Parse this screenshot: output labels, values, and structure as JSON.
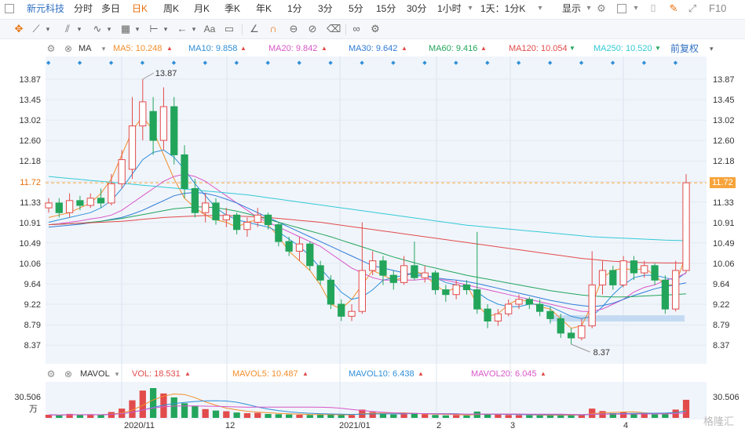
{
  "toolbar": {
    "stock_name": "新元科技",
    "periods": [
      {
        "label": "分时",
        "active": false
      },
      {
        "label": "多日",
        "active": false
      },
      {
        "label": "日K",
        "active": true
      },
      {
        "label": "周K",
        "active": false
      },
      {
        "label": "月K",
        "active": false
      },
      {
        "label": "季K",
        "active": false
      },
      {
        "label": "年K",
        "active": false
      },
      {
        "label": "1分",
        "active": false
      },
      {
        "label": "3分",
        "active": false
      },
      {
        "label": "5分",
        "active": false
      },
      {
        "label": "15分",
        "active": false
      },
      {
        "label": "30分",
        "active": false
      },
      {
        "label": "1小时",
        "active": false
      },
      {
        "label": "1天：1分K",
        "active": false
      }
    ],
    "display_label": "显示",
    "f10_label": "F10"
  },
  "ma_legend": {
    "title": "MA",
    "items": [
      {
        "label": "MA5: 10.248",
        "color": "#f28e2b",
        "trend": "up"
      },
      {
        "label": "MA10: 9.858",
        "color": "#2f8fd8",
        "trend": "up"
      },
      {
        "label": "MA20: 9.842",
        "color": "#d957c8",
        "trend": "up"
      },
      {
        "label": "MA30: 9.642",
        "color": "#2f7bd8",
        "trend": "up"
      },
      {
        "label": "MA60: 9.416",
        "color": "#22a55b",
        "trend": "up"
      },
      {
        "label": "MA120: 10.054",
        "color": "#e24b4b",
        "trend": "down"
      },
      {
        "label": "MA250: 10.520",
        "color": "#33c9d6",
        "trend": "down"
      }
    ],
    "adjust_label": "前复权"
  },
  "price_axis": [
    "13.87",
    "13.45",
    "13.02",
    "12.60",
    "12.18",
    "11.72",
    "11.33",
    "10.91",
    "10.49",
    "10.06",
    "9.64",
    "9.22",
    "8.79",
    "8.37"
  ],
  "current_price": "11.72",
  "high_label": "13.87",
  "low_label": "8.37",
  "vol_legend": {
    "title": "MAVOL",
    "items": [
      {
        "label": "VOL: 18.531",
        "color": "#e24b4b",
        "trend": "up"
      },
      {
        "label": "MAVOL5: 10.487",
        "color": "#f28e2b",
        "trend": "up"
      },
      {
        "label": "MAVOL10: 6.438",
        "color": "#2f8fd8",
        "trend": "up"
      },
      {
        "label": "MAVOL20: 6.045",
        "color": "#d957c8",
        "trend": "up"
      }
    ],
    "axis_max": "30.506",
    "axis_unit": "万"
  },
  "x_axis": [
    "2020/11",
    "12",
    "2021/01",
    "2",
    "3",
    "4"
  ],
  "watermark": "格隆汇",
  "colors": {
    "up": "#e24b4b",
    "down": "#22a55b",
    "accent": "#e8700d",
    "bg": "#f0f5fb"
  },
  "chart_data": {
    "type": "candlestick",
    "ylim": [
      8.37,
      13.87
    ],
    "series": [
      {
        "name": "MA5",
        "values": [
          11.0,
          11.05,
          11.1,
          11.2,
          11.3,
          11.5,
          11.8,
          12.3,
          12.8,
          13.1,
          12.8,
          12.3,
          11.8,
          11.4,
          11.2,
          11.05,
          10.95,
          10.9,
          10.8,
          10.9,
          10.95,
          10.85,
          10.6,
          10.3,
          10.1,
          9.9,
          9.6,
          9.2,
          9.1,
          9.3,
          9.6,
          9.9,
          9.8,
          9.7,
          9.75,
          9.9,
          9.8,
          9.6,
          9.45,
          9.55,
          9.6,
          9.2,
          8.95,
          9.0,
          9.2,
          9.3,
          9.25,
          9.15,
          9.1,
          8.9,
          8.7,
          8.75,
          9.2,
          9.75,
          9.9,
          9.95,
          9.9,
          9.95,
          9.8,
          9.6,
          9.6,
          10.248
        ]
      },
      {
        "name": "MA10",
        "values": [
          10.9,
          10.95,
          11.0,
          11.05,
          11.1,
          11.2,
          11.35,
          11.6,
          11.9,
          12.2,
          12.35,
          12.4,
          12.25,
          12.0,
          11.7,
          11.45,
          11.2,
          11.05,
          10.95,
          10.9,
          10.85,
          10.8,
          10.7,
          10.55,
          10.4,
          10.2,
          9.95,
          9.7,
          9.45,
          9.3,
          9.35,
          9.5,
          9.7,
          9.75,
          9.8,
          9.85,
          9.8,
          9.75,
          9.65,
          9.6,
          9.55,
          9.45,
          9.3,
          9.2,
          9.15,
          9.15,
          9.2,
          9.2,
          9.15,
          9.05,
          8.95,
          8.9,
          8.95,
          9.15,
          9.4,
          9.6,
          9.75,
          9.8,
          9.8,
          9.75,
          9.7,
          9.858
        ]
      },
      {
        "name": "MA20",
        "values": [
          10.85,
          10.87,
          10.9,
          10.93,
          10.97,
          11.0,
          11.05,
          11.15,
          11.3,
          11.45,
          11.6,
          11.75,
          11.85,
          11.9,
          11.85,
          11.75,
          11.6,
          11.45,
          11.3,
          11.15,
          11.0,
          10.9,
          10.8,
          10.7,
          10.6,
          10.5,
          10.4,
          10.25,
          10.1,
          9.95,
          9.85,
          9.75,
          9.7,
          9.7,
          9.7,
          9.7,
          9.72,
          9.72,
          9.7,
          9.65,
          9.6,
          9.55,
          9.5,
          9.45,
          9.4,
          9.35,
          9.3,
          9.25,
          9.2,
          9.15,
          9.1,
          9.05,
          9.05,
          9.1,
          9.2,
          9.3,
          9.45,
          9.55,
          9.6,
          9.7,
          9.75,
          9.842
        ]
      },
      {
        "name": "MA30",
        "values": [
          10.8,
          10.82,
          10.84,
          10.86,
          10.89,
          10.92,
          10.96,
          11.0,
          11.07,
          11.15,
          11.25,
          11.35,
          11.45,
          11.5,
          11.52,
          11.5,
          11.45,
          11.38,
          11.3,
          11.2,
          11.1,
          11.0,
          10.9,
          10.8,
          10.7,
          10.6,
          10.5,
          10.4,
          10.3,
          10.2,
          10.1,
          10.0,
          9.95,
          9.9,
          9.85,
          9.8,
          9.78,
          9.75,
          9.72,
          9.7,
          9.67,
          9.63,
          9.58,
          9.53,
          9.48,
          9.43,
          9.38,
          9.33,
          9.28,
          9.24,
          9.2,
          9.17,
          9.15,
          9.17,
          9.22,
          9.3,
          9.38,
          9.45,
          9.52,
          9.57,
          9.6,
          9.642
        ]
      },
      {
        "name": "MA60",
        "values": [
          10.85,
          10.86,
          10.87,
          10.88,
          10.9,
          10.92,
          10.95,
          10.98,
          11.02,
          11.06,
          11.1,
          11.14,
          11.18,
          11.2,
          11.22,
          11.22,
          11.2,
          11.17,
          11.13,
          11.08,
          11.02,
          10.96,
          10.9,
          10.84,
          10.78,
          10.72,
          10.66,
          10.6,
          10.53,
          10.46,
          10.39,
          10.32,
          10.25,
          10.18,
          10.12,
          10.06,
          10.0,
          9.95,
          9.9,
          9.85,
          9.8,
          9.76,
          9.72,
          9.68,
          9.64,
          9.6,
          9.56,
          9.52,
          9.48,
          9.45,
          9.42,
          9.39,
          9.37,
          9.36,
          9.35,
          9.35,
          9.36,
          9.37,
          9.38,
          9.39,
          9.4,
          9.416
        ]
      },
      {
        "name": "MA120",
        "values": [
          10.85,
          10.86,
          10.87,
          10.88,
          10.89,
          10.9,
          10.91,
          10.92,
          10.94,
          10.96,
          10.98,
          11.0,
          11.01,
          11.02,
          11.03,
          11.04,
          11.04,
          11.04,
          11.03,
          11.02,
          11.01,
          11.0,
          10.98,
          10.96,
          10.94,
          10.92,
          10.9,
          10.87,
          10.84,
          10.81,
          10.78,
          10.75,
          10.72,
          10.69,
          10.66,
          10.63,
          10.6,
          10.57,
          10.54,
          10.51,
          10.48,
          10.45,
          10.42,
          10.39,
          10.36,
          10.33,
          10.3,
          10.27,
          10.24,
          10.21,
          10.18,
          10.15,
          10.13,
          10.11,
          10.09,
          10.08,
          10.07,
          10.06,
          10.06,
          10.055,
          10.055,
          10.054
        ]
      },
      {
        "name": "MA250",
        "values": [
          11.85,
          11.83,
          11.81,
          11.79,
          11.77,
          11.75,
          11.73,
          11.71,
          11.69,
          11.67,
          11.65,
          11.63,
          11.61,
          11.59,
          11.57,
          11.55,
          11.53,
          11.51,
          11.49,
          11.47,
          11.44,
          11.41,
          11.38,
          11.35,
          11.32,
          11.29,
          11.26,
          11.23,
          11.2,
          11.17,
          11.14,
          11.11,
          11.08,
          11.05,
          11.02,
          10.99,
          10.96,
          10.93,
          10.9,
          10.87,
          10.84,
          10.82,
          10.8,
          10.78,
          10.76,
          10.74,
          10.72,
          10.7,
          10.68,
          10.66,
          10.64,
          10.62,
          10.6,
          10.59,
          10.58,
          10.57,
          10.56,
          10.55,
          10.54,
          10.53,
          10.525,
          10.52
        ]
      }
    ],
    "candles": [
      {
        "o": 11.2,
        "c": 11.3,
        "h": 11.4,
        "l": 11.1
      },
      {
        "o": 11.3,
        "c": 11.1,
        "h": 11.4,
        "l": 11.0
      },
      {
        "o": 11.1,
        "c": 11.35,
        "h": 11.5,
        "l": 11.0
      },
      {
        "o": 11.35,
        "c": 11.25,
        "h": 11.45,
        "l": 11.15
      },
      {
        "o": 11.25,
        "c": 11.4,
        "h": 11.5,
        "l": 11.2
      },
      {
        "o": 11.4,
        "c": 11.3,
        "h": 11.6,
        "l": 11.2
      },
      {
        "o": 11.3,
        "c": 11.7,
        "h": 11.9,
        "l": 11.25
      },
      {
        "o": 11.7,
        "c": 12.2,
        "h": 12.4,
        "l": 11.6
      },
      {
        "o": 12.0,
        "c": 12.9,
        "h": 13.5,
        "l": 11.8
      },
      {
        "o": 12.9,
        "c": 13.4,
        "h": 13.87,
        "l": 12.6
      },
      {
        "o": 13.2,
        "c": 12.6,
        "h": 13.5,
        "l": 12.3
      },
      {
        "o": 12.6,
        "c": 13.3,
        "h": 13.7,
        "l": 12.4
      },
      {
        "o": 13.3,
        "c": 12.3,
        "h": 13.5,
        "l": 12.1
      },
      {
        "o": 12.3,
        "c": 11.6,
        "h": 12.5,
        "l": 11.4
      },
      {
        "o": 11.6,
        "c": 11.1,
        "h": 11.8,
        "l": 11.0
      },
      {
        "o": 11.1,
        "c": 11.3,
        "h": 11.5,
        "l": 10.9
      },
      {
        "o": 11.3,
        "c": 10.95,
        "h": 11.4,
        "l": 10.85
      },
      {
        "o": 10.95,
        "c": 11.05,
        "h": 11.2,
        "l": 10.8
      },
      {
        "o": 11.05,
        "c": 10.75,
        "h": 11.1,
        "l": 10.65
      },
      {
        "o": 10.75,
        "c": 10.9,
        "h": 11.0,
        "l": 10.6
      },
      {
        "o": 10.9,
        "c": 11.05,
        "h": 11.2,
        "l": 10.8
      },
      {
        "o": 11.05,
        "c": 10.85,
        "h": 11.1,
        "l": 10.75
      },
      {
        "o": 10.85,
        "c": 10.5,
        "h": 10.9,
        "l": 10.4
      },
      {
        "o": 10.5,
        "c": 10.3,
        "h": 10.6,
        "l": 10.2
      },
      {
        "o": 10.3,
        "c": 10.45,
        "h": 10.6,
        "l": 10.1
      },
      {
        "o": 10.45,
        "c": 10.0,
        "h": 10.5,
        "l": 9.9
      },
      {
        "o": 10.0,
        "c": 9.7,
        "h": 10.1,
        "l": 9.6
      },
      {
        "o": 9.7,
        "c": 9.2,
        "h": 9.8,
        "l": 9.1
      },
      {
        "o": 9.2,
        "c": 8.95,
        "h": 9.3,
        "l": 8.85
      },
      {
        "o": 8.95,
        "c": 9.05,
        "h": 9.2,
        "l": 8.85
      },
      {
        "o": 9.05,
        "c": 9.9,
        "h": 10.9,
        "l": 9.0
      },
      {
        "o": 9.9,
        "c": 10.1,
        "h": 10.3,
        "l": 9.8
      },
      {
        "o": 10.1,
        "c": 9.8,
        "h": 10.2,
        "l": 9.6
      },
      {
        "o": 9.8,
        "c": 9.65,
        "h": 9.9,
        "l": 9.5
      },
      {
        "o": 9.65,
        "c": 10.0,
        "h": 10.2,
        "l": 9.6
      },
      {
        "o": 10.0,
        "c": 9.75,
        "h": 10.5,
        "l": 9.7
      },
      {
        "o": 9.75,
        "c": 9.85,
        "h": 10.0,
        "l": 9.65
      },
      {
        "o": 9.85,
        "c": 9.5,
        "h": 9.9,
        "l": 9.4
      },
      {
        "o": 9.5,
        "c": 9.4,
        "h": 9.6,
        "l": 9.25
      },
      {
        "o": 9.4,
        "c": 9.6,
        "h": 9.7,
        "l": 9.3
      },
      {
        "o": 9.6,
        "c": 9.5,
        "h": 9.7,
        "l": 9.4
      },
      {
        "o": 9.5,
        "c": 9.1,
        "h": 10.7,
        "l": 9.0
      },
      {
        "o": 9.1,
        "c": 8.85,
        "h": 9.2,
        "l": 8.7
      },
      {
        "o": 8.85,
        "c": 9.0,
        "h": 9.1,
        "l": 8.75
      },
      {
        "o": 9.0,
        "c": 9.2,
        "h": 9.3,
        "l": 8.95
      },
      {
        "o": 9.2,
        "c": 9.3,
        "h": 9.4,
        "l": 9.1
      },
      {
        "o": 9.3,
        "c": 9.2,
        "h": 9.35,
        "l": 9.1
      },
      {
        "o": 9.2,
        "c": 9.05,
        "h": 9.3,
        "l": 8.95
      },
      {
        "o": 9.05,
        "c": 8.9,
        "h": 9.15,
        "l": 8.8
      },
      {
        "o": 8.9,
        "c": 8.6,
        "h": 9.0,
        "l": 8.5
      },
      {
        "o": 8.6,
        "c": 8.5,
        "h": 8.7,
        "l": 8.37
      },
      {
        "o": 8.5,
        "c": 8.75,
        "h": 8.9,
        "l": 8.45
      },
      {
        "o": 8.75,
        "c": 9.6,
        "h": 10.3,
        "l": 8.7
      },
      {
        "o": 9.6,
        "c": 9.9,
        "h": 10.1,
        "l": 9.4
      },
      {
        "o": 9.9,
        "c": 9.6,
        "h": 10.0,
        "l": 9.5
      },
      {
        "o": 9.6,
        "c": 10.1,
        "h": 10.2,
        "l": 9.55
      },
      {
        "o": 10.1,
        "c": 9.85,
        "h": 10.2,
        "l": 9.7
      },
      {
        "o": 9.85,
        "c": 10.0,
        "h": 10.1,
        "l": 9.75
      },
      {
        "o": 10.0,
        "c": 9.7,
        "h": 10.05,
        "l": 9.6
      },
      {
        "o": 9.7,
        "c": 9.1,
        "h": 9.8,
        "l": 9.0
      },
      {
        "o": 9.1,
        "c": 9.9,
        "h": 10.1,
        "l": 9.05
      },
      {
        "o": 9.9,
        "c": 11.72,
        "h": 11.9,
        "l": 9.85
      }
    ],
    "volume": [
      3.2,
      2.5,
      4.1,
      3.0,
      3.5,
      2.8,
      6.0,
      9.5,
      18.0,
      28.0,
      30.5,
      25.0,
      21.0,
      15.0,
      12.0,
      9.0,
      7.5,
      6.8,
      5.5,
      4.8,
      5.2,
      4.0,
      3.8,
      3.5,
      3.2,
      3.0,
      3.4,
      3.6,
      3.0,
      2.8,
      8.5,
      6.0,
      4.2,
      3.5,
      3.9,
      5.0,
      3.6,
      3.0,
      2.6,
      2.9,
      2.5,
      6.5,
      4.0,
      3.2,
      3.0,
      2.8,
      2.7,
      2.6,
      2.5,
      3.0,
      3.4,
      3.1,
      9.5,
      7.0,
      4.8,
      5.6,
      4.5,
      4.0,
      3.6,
      3.9,
      8.5,
      18.531
    ]
  }
}
